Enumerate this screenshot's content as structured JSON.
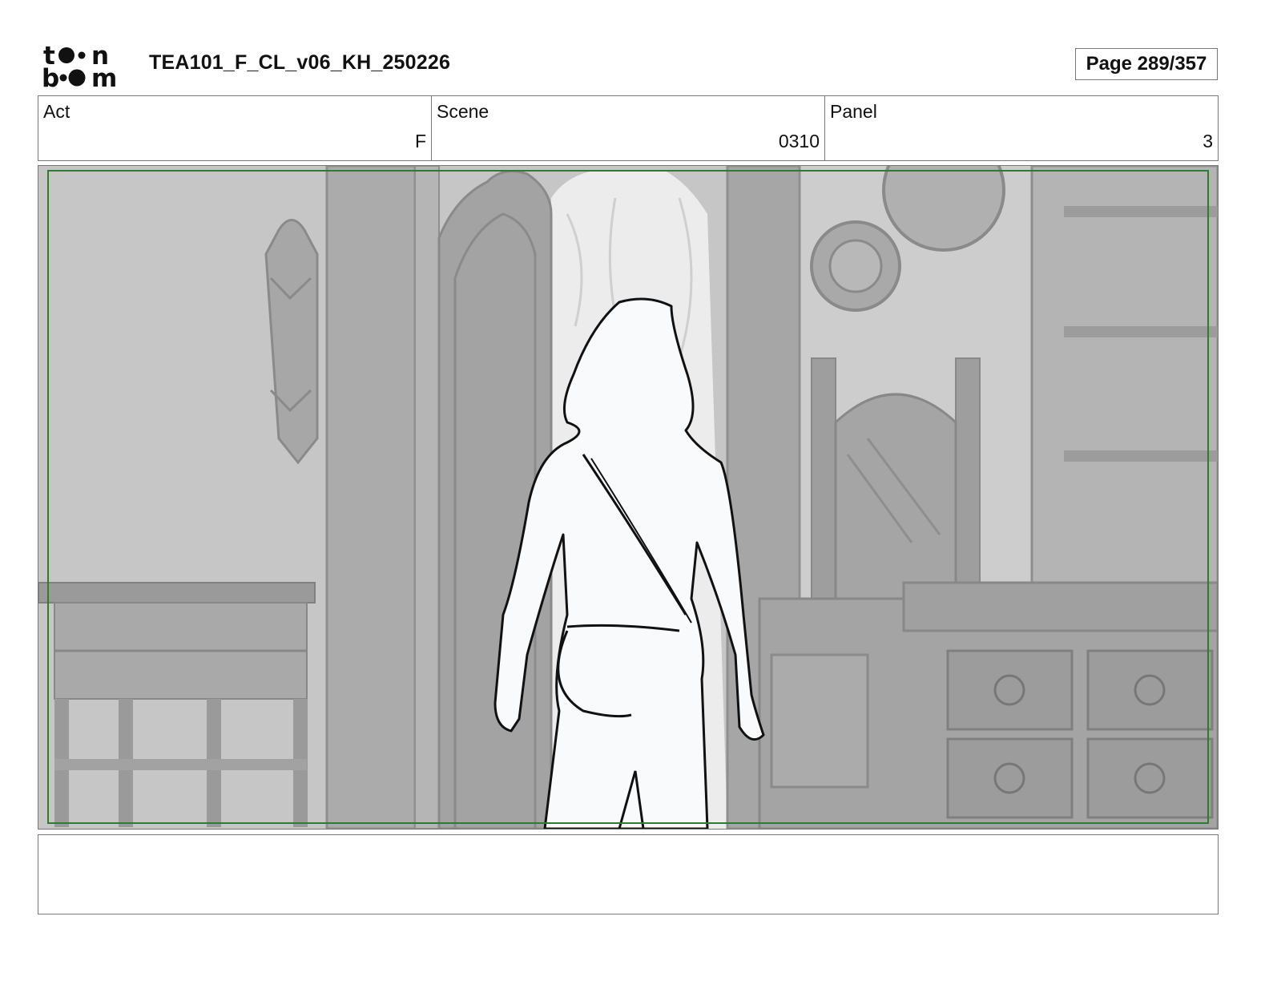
{
  "header": {
    "logo_text": "toon boom",
    "doc_title": "TEA101_F_CL_v06_KH_250226",
    "page_label": "Page 289/357"
  },
  "info": {
    "act_label": "Act",
    "act_value": "F",
    "scene_label": "Scene",
    "scene_value": "0310",
    "panel_label": "Panel",
    "panel_value": "3"
  },
  "notes": {
    "text": ""
  },
  "colors": {
    "safe_frame": "#2e7d2e",
    "wall": "#c4c4c4",
    "furniture": "#a9a9a9",
    "figure": "#f9fafc"
  }
}
